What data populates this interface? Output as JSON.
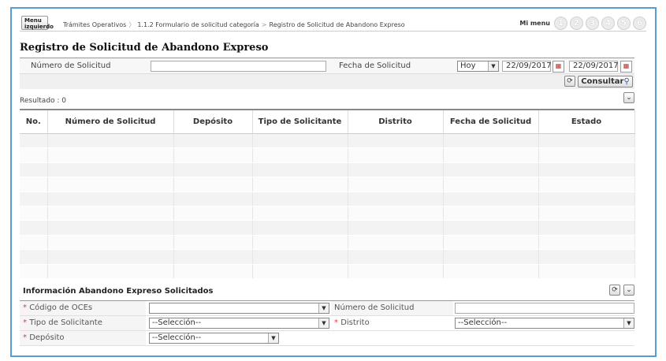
{
  "topbar": {
    "menu_label": "Menu izquierdo",
    "breadcrumb": [
      "Trámites Operativos",
      "1.1.2 Formulario de solicitud categoría",
      "Registro de Solicitud de Abandono Expreso"
    ],
    "breadcrumb_sep1": "〉",
    "breadcrumb_sep2": ">",
    "mi_menu_label": "Mi menu",
    "shortcuts": [
      "1",
      "2",
      "3",
      "4",
      "5",
      "6"
    ]
  },
  "page_title": "Registro de Solicitud de Abandono Expreso",
  "search": {
    "numero_label": "Número de Solicitud",
    "numero_value": "",
    "fecha_label": "Fecha de Solicitud",
    "fecha_option": "Hoy",
    "fecha_desde": "22/09/2017",
    "fecha_hasta": "22/09/2017",
    "consultar_label": "Consultar"
  },
  "result_label": "Resultado : 0",
  "table": {
    "columns": [
      "No.",
      "Número de Solicitud",
      "Depósito",
      "Tipo de Solicitante",
      "Distrito",
      "Fecha de Solicitud",
      "Estado"
    ],
    "rows": []
  },
  "info": {
    "title": "Información Abandono Expreso Solicitados",
    "codigo_label": "Código de OCEs",
    "codigo_value": "",
    "numero_label": "Número de Solicitud",
    "numero_value": "",
    "tipo_label": "Tipo de Solicitante",
    "tipo_value": "--Selección--",
    "distrito_label": "Distrito",
    "distrito_value": "--Selección--",
    "deposito_label": "Depósito",
    "deposito_value": "--Selección--",
    "required_mark": "*"
  },
  "colors": {
    "frame_border": "#5b9bd5",
    "required": "#e04040"
  },
  "icons": [
    "refresh-icon",
    "search-icon",
    "calendar-icon",
    "chevron-down-icon"
  ]
}
